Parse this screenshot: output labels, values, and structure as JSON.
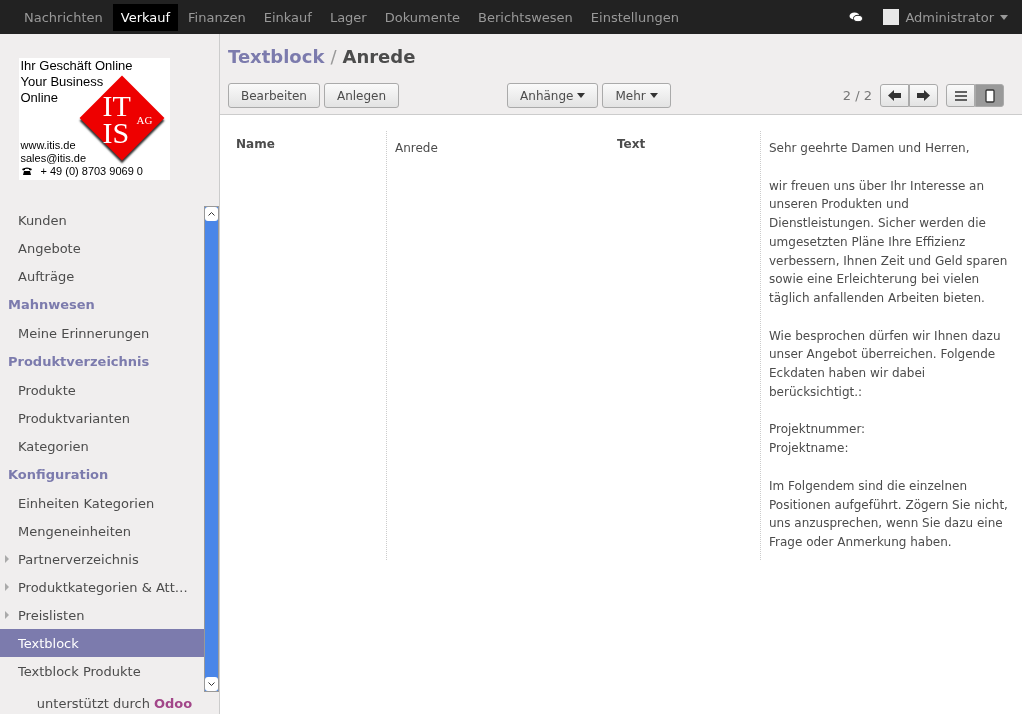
{
  "topbar": {
    "menus": [
      {
        "label": "Nachrichten",
        "selected": false
      },
      {
        "label": "Verkauf",
        "selected": true
      },
      {
        "label": "Finanzen",
        "selected": false
      },
      {
        "label": "Einkauf",
        "selected": false
      },
      {
        "label": "Lager",
        "selected": false
      },
      {
        "label": "Dokumente",
        "selected": false
      },
      {
        "label": "Berichtswesen",
        "selected": false
      },
      {
        "label": "Einstellungen",
        "selected": false
      }
    ],
    "user": "Administrator"
  },
  "logo": {
    "lines": [
      "Ihr Geschäft Online",
      "Your Business",
      "Online"
    ],
    "mark_top": "IT",
    "mark_bottom": "IS",
    "mark_suffix": "AG",
    "web": "www.itis.de",
    "mail": "sales@itis.de",
    "phone": "+ 49 (0) 8703 9069 0"
  },
  "sidebar": {
    "items": [
      {
        "kind": "item",
        "label": "Kunden",
        "selected": false,
        "expandable": false
      },
      {
        "kind": "item",
        "label": "Angebote",
        "selected": false,
        "expandable": false
      },
      {
        "kind": "item",
        "label": "Aufträge",
        "selected": false,
        "expandable": false
      },
      {
        "kind": "header",
        "label": "Mahnwesen"
      },
      {
        "kind": "item",
        "label": "Meine Erinnerungen",
        "selected": false,
        "expandable": false
      },
      {
        "kind": "header",
        "label": "Produktverzeichnis"
      },
      {
        "kind": "item",
        "label": "Produkte",
        "selected": false,
        "expandable": false
      },
      {
        "kind": "item",
        "label": "Produktvarianten",
        "selected": false,
        "expandable": false
      },
      {
        "kind": "item",
        "label": "Kategorien",
        "selected": false,
        "expandable": false
      },
      {
        "kind": "header",
        "label": "Konfiguration"
      },
      {
        "kind": "item",
        "label": "Einheiten Kategorien",
        "selected": false,
        "expandable": false
      },
      {
        "kind": "item",
        "label": "Mengeneinheiten",
        "selected": false,
        "expandable": false
      },
      {
        "kind": "item",
        "label": "Partnerverzeichnis",
        "selected": false,
        "expandable": true
      },
      {
        "kind": "item",
        "label": "Produktkategorien & Att…",
        "selected": false,
        "expandable": true
      },
      {
        "kind": "item",
        "label": "Preislisten",
        "selected": false,
        "expandable": true
      },
      {
        "kind": "item",
        "label": "Textblock",
        "selected": true,
        "expandable": false
      },
      {
        "kind": "item",
        "label": "Textblock Produkte",
        "selected": false,
        "expandable": false
      }
    ],
    "footer_text": "unterstützt durch",
    "footer_brand": "Odoo"
  },
  "breadcrumb": {
    "parent": "Textblock",
    "separator": "/",
    "current": "Anrede"
  },
  "toolbar": {
    "left_buttons": [
      "Bearbeiten",
      "Anlegen"
    ],
    "dropdowns": [
      "Anhänge",
      "Mehr"
    ],
    "pager": "2 / 2",
    "views": [
      {
        "kind": "list",
        "selected": false
      },
      {
        "kind": "form",
        "selected": true
      }
    ]
  },
  "form": {
    "fields": [
      {
        "label": "Name",
        "value": [
          "Anrede"
        ]
      },
      {
        "label": "Text",
        "value": [
          "Sehr geehrte Damen und Herren,",
          "wir freuen uns über Ihr Interesse an unseren Produkten und Dienstleistungen. Sicher werden die umgesetzten Pläne Ihre Effizienz verbessern, Ihnen Zeit und Geld sparen sowie eine Erleichterung bei vielen täglich anfallenden Arbeiten bieten.",
          "Wie besprochen dürfen wir Ihnen dazu unser Angebot überreichen. Folgende Eckdaten haben wir dabei berücksichtigt.:",
          "Projektnummer:\nProjektname:",
          "Im Folgendem sind die einzelnen Positionen aufgeführt. Zögern Sie nicht, uns anzusprechen, wenn Sie dazu eine Frage oder Anmerkung haben."
        ]
      }
    ]
  }
}
